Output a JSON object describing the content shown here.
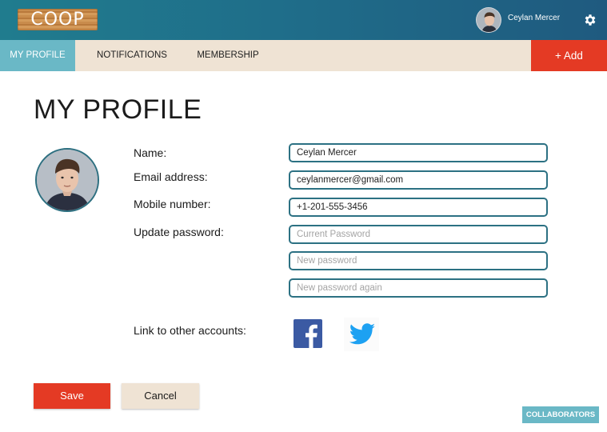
{
  "header": {
    "logo_text": "COOP",
    "user_name": "Ceylan Mercer",
    "avatar_icon": "user-avatar",
    "settings_icon": "gear-icon"
  },
  "nav": {
    "tabs": [
      {
        "label": "MY PROFILE",
        "active": true
      },
      {
        "label": "NOTIFICATIONS",
        "active": false
      },
      {
        "label": "MEMBERSHIP",
        "active": false
      }
    ],
    "add_label": "+ Add"
  },
  "profile": {
    "title": "MY PROFILE",
    "labels": {
      "name": "Name:",
      "email": "Email address:",
      "mobile": "Mobile number:",
      "password": "Update password:",
      "link_accounts": "Link to other accounts:"
    },
    "values": {
      "name": "Ceylan Mercer",
      "email": "ceylanmercer@gmail.com",
      "mobile": "+1-201-555-3456"
    },
    "placeholders": {
      "current_password": "Current Password",
      "new_password": "New password",
      "new_password_again": "New password again"
    },
    "social": [
      "facebook-icon",
      "twitter-icon"
    ]
  },
  "actions": {
    "save_label": "Save",
    "cancel_label": "Cancel",
    "collaborators_label": "COLLABORATORS"
  },
  "colors": {
    "header_teal": "#207c8e",
    "nav_beige": "#efe3d4",
    "active_tab": "#6ab8c6",
    "accent_red": "#e43a24",
    "field_border": "#2c7183"
  }
}
